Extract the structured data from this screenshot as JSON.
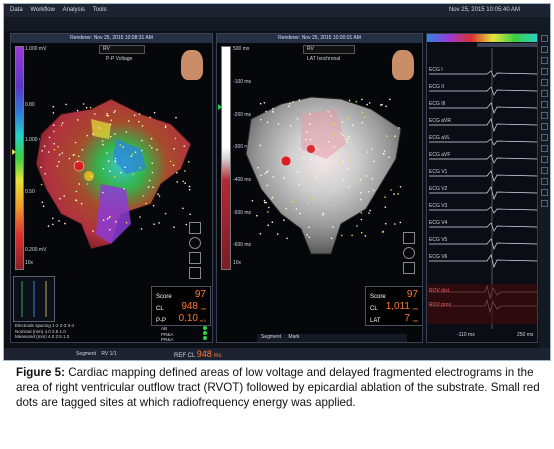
{
  "menu": {
    "items": [
      "Data",
      "Workflow",
      "Analysis",
      "Tools"
    ],
    "clock": "Nov 25, 2015 10:05:40 AM"
  },
  "left_panel": {
    "title": "Renderer: Nov 25, 2015 10:08:31 AM",
    "map_dropdown": "RV",
    "map_type": "P-P Voltage",
    "scale_top": "1.000 mV",
    "scale_mid": "0.80",
    "scale_mid2": "1.000 mV",
    "scale_low": "0.50",
    "scale_bottom": "0.200 mV",
    "scale_mark": "10x",
    "score": {
      "label": "Score",
      "value": "97"
    },
    "cl": {
      "label": "CL",
      "value": "948",
      "unit": "ms"
    },
    "pp": {
      "label": "P-P",
      "value": "0.10",
      "unit": "mV"
    },
    "spacing_label": "Electrode spacing",
    "spacing_cols": "1-2  2-3  3-4",
    "nominal_label": "Nominal (mm)",
    "nominal_vals": "4.0  2.5  1.0",
    "measured_label": "Measured (mm)",
    "measured_vals": "4.0  2.5  1.0",
    "rc_labels": [
      "AB",
      "PR&A",
      "PR&A"
    ]
  },
  "middle_panel": {
    "title": "Renderer: Nov 25, 2015 10:00:01 AM",
    "map_dropdown": "RV",
    "map_type": "LAT Isochronal",
    "scale_top": "500 ms",
    "scale_marks": [
      "-100 ms",
      "-200 ms",
      "-300 ms",
      "-400 ms",
      "-500 ms",
      "-600 ms"
    ],
    "scale_mark_bottom": "10x",
    "score": {
      "label": "Score",
      "value": "97"
    },
    "cl": {
      "label": "CL",
      "value": "1,011",
      "unit": "ms"
    },
    "lat": {
      "label": "LAT",
      "value": "7",
      "unit": "ms"
    },
    "segment_label": "Segment",
    "segment_value": "Mark"
  },
  "ecg_panel": {
    "leads": [
      "ECG I",
      "ECG II",
      "ECG III",
      "ECG aVR",
      "ECG aVL",
      "ECG aVF",
      "ECG V1",
      "ECG V2",
      "ECG V3",
      "ECG V4",
      "ECG V5",
      "ECG V6"
    ],
    "roving": [
      "ROV dist",
      "ROV prox"
    ],
    "time_left": "-110 ms",
    "time_right": "250 ms"
  },
  "status": {
    "cl_label": "REF CL",
    "cl_value": "948",
    "cl_unit": "ms",
    "segment_label": "Segment",
    "segment_value": "RV 1/1"
  },
  "caption": {
    "figure": "Figure 5:",
    "text": "Cardiac mapping defined areas of low voltage and delayed fragmented electrograms in the area of right ventricular outflow tract (RVOT) followed by epicardial ablation of the substrate. Small red dots are tagged sites at which radiofrequency energy was applied."
  },
  "colors": {
    "accent": "#ff7b2f",
    "panel_bg": "#05070b",
    "frame_border": "#9fb7c9",
    "scar": "#b0313f",
    "map_purple": "#9b3ad9"
  }
}
